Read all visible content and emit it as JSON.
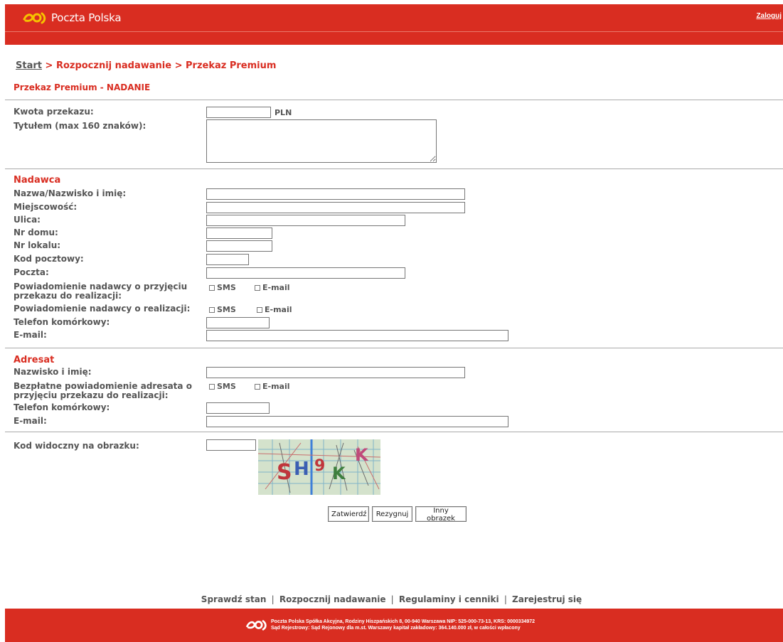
{
  "header": {
    "logo_text": "Poczta Polska",
    "login_link": "Zaloguj"
  },
  "breadcrumb": {
    "start": "Start",
    "sep1": " > ",
    "step2": "Rozpocznij nadawanie",
    "sep2": " > ",
    "step3": "Przekaz Premium"
  },
  "section_title": "Przekaz Premium - NADANIE",
  "transfer": {
    "amount_label": "Kwota przekazu:",
    "amount_value": "",
    "currency": "PLN",
    "title_label": "Tytułem (max 160 znaków):",
    "title_value": ""
  },
  "sender": {
    "heading": "Nadawca",
    "name_label": "Nazwa/Nazwisko i imię:",
    "city_label": "Miejscowość:",
    "street_label": "Ulica:",
    "house_label": "Nr domu:",
    "flat_label": "Nr lokalu:",
    "postcode_label": "Kod pocztowy:",
    "post_label": "Poczta:",
    "notify_accept_label_1": "Powiadomienie nadawcy o przyjęciu",
    "notify_accept_label_2": "przekazu do realizacji:",
    "notify_done_label": "Powiadomienie nadawcy o realizacji:",
    "phone_label": "Telefon komórkowy:",
    "email_label": "E-mail:"
  },
  "recipient": {
    "heading": "Adresat",
    "name_label": "Nazwisko i imię:",
    "notify_label_1": "Bezpłatne powiadomienie adresata o",
    "notify_label_2": "przyjęciu przekazu do realizacji:",
    "phone_label": "Telefon komórkowy:",
    "email_label": "E-mail:"
  },
  "options": {
    "sms": "SMS",
    "email": "E-mail"
  },
  "captcha": {
    "label": "Kod widoczny na obrazku:",
    "chars": [
      "S",
      "H",
      "9",
      "K",
      "K"
    ]
  },
  "buttons": {
    "submit": "Zatwierdź",
    "cancel": "Rezygnuj",
    "other_image": "Inny obrazek"
  },
  "footer": {
    "links": [
      "Sprawdź stan",
      "Rozpocznij nadawanie",
      "Regulaminy i cenniki",
      "Zarejestruj się"
    ],
    "separator": "|",
    "line1": "Poczta Polska Spółka Akcyjna, Rodziny Hiszpańskich 8, 00-940 Warszawa NIP: 525-000-73-13, KRS: 0000334972",
    "line2": "Sąd Rejestrowy: Sąd Rejonowy dla m.st. Warszawy kapitał zakładowy: 364.140.000 zł, w całości wpłacony"
  },
  "colors": {
    "brand_red": "#d92d21",
    "brand_yellow": "#f6c200"
  },
  "icons": {
    "logo": "poczta-polska-horn-icon"
  }
}
